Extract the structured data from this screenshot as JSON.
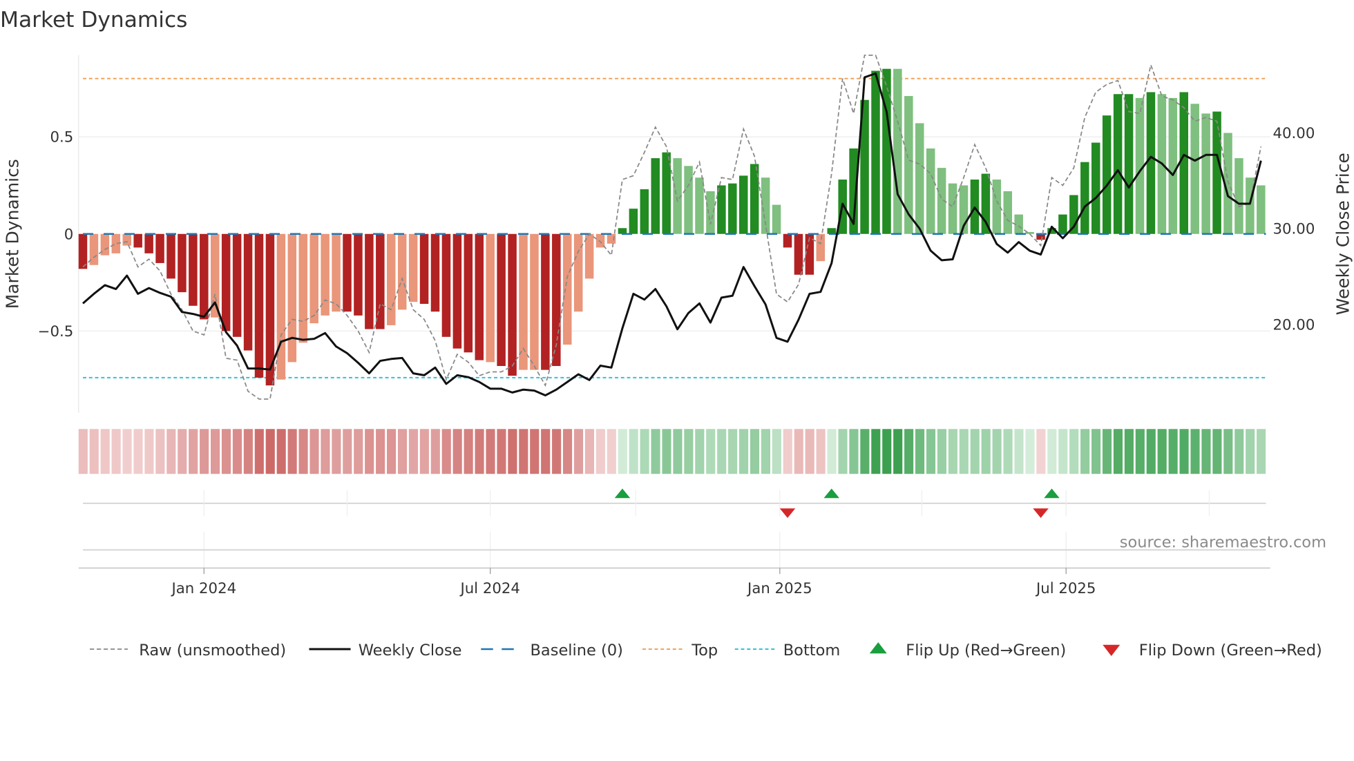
{
  "chart_data": {
    "type": "bar",
    "title": "Market Dynamics",
    "ylabel": "Market Dynamics",
    "y2label": "Weekly Close Price",
    "ylim": [
      -0.92,
      0.92
    ],
    "y2lim": [
      10.8,
      48.1
    ],
    "yticks": [
      {
        "v": 0.5,
        "label": "0.5"
      },
      {
        "v": 0,
        "label": "0"
      },
      {
        "v": -0.5,
        "label": "−0.5"
      }
    ],
    "y2ticks": [
      {
        "v": 40,
        "label": "40.00"
      },
      {
        "v": 30,
        "label": "30.00"
      },
      {
        "v": 20,
        "label": "20.00"
      }
    ],
    "xticks": [
      {
        "week": 11,
        "label": "Jan 2024"
      },
      {
        "week": 37,
        "label": "Jul 2024"
      },
      {
        "week": 63.3,
        "label": "Jan 2025"
      },
      {
        "week": 89.3,
        "label": "Jul 2025"
      }
    ],
    "minor_xticks": [
      24,
      50.2,
      76.2,
      102.3
    ],
    "weeks_start": "2023-10-16 (approx.)",
    "top_level": 0.8,
    "bottom_level": -0.74,
    "baseline": 0,
    "momentum": [
      -0.18,
      -0.16,
      -0.11,
      -0.1,
      -0.06,
      -0.07,
      -0.1,
      -0.15,
      -0.23,
      -0.3,
      -0.37,
      -0.44,
      -0.43,
      -0.5,
      -0.53,
      -0.6,
      -0.74,
      -0.78,
      -0.75,
      -0.66,
      -0.56,
      -0.46,
      -0.42,
      -0.4,
      -0.4,
      -0.42,
      -0.49,
      -0.49,
      -0.47,
      -0.39,
      -0.35,
      -0.36,
      -0.4,
      -0.53,
      -0.59,
      -0.61,
      -0.65,
      -0.66,
      -0.68,
      -0.73,
      -0.7,
      -0.7,
      -0.7,
      -0.68,
      -0.57,
      -0.4,
      -0.23,
      -0.07,
      -0.05,
      0.03,
      0.13,
      0.23,
      0.39,
      0.42,
      0.39,
      0.35,
      0.29,
      0.22,
      0.25,
      0.26,
      0.3,
      0.36,
      0.29,
      0.15,
      -0.07,
      -0.21,
      -0.21,
      -0.14,
      0.03,
      0.28,
      0.44,
      0.69,
      0.84,
      0.85,
      0.85,
      0.71,
      0.57,
      0.44,
      0.34,
      0.26,
      0.25,
      0.28,
      0.31,
      0.28,
      0.22,
      0.1,
      0.01,
      -0.03,
      0.03,
      0.1,
      0.2,
      0.37,
      0.47,
      0.61,
      0.72,
      0.72,
      0.7,
      0.73,
      0.72,
      0.7,
      0.73,
      0.67,
      0.62,
      0.63,
      0.52,
      0.39,
      0.29,
      0.25
    ],
    "strong": [
      1,
      0,
      0,
      0,
      0,
      1,
      1,
      1,
      1,
      1,
      1,
      1,
      0,
      1,
      1,
      1,
      1,
      1,
      0,
      0,
      0,
      0,
      0,
      0,
      1,
      1,
      1,
      1,
      0,
      0,
      0,
      1,
      1,
      1,
      1,
      1,
      1,
      0,
      1,
      1,
      0,
      0,
      1,
      1,
      0,
      0,
      0,
      0,
      0,
      1,
      1,
      1,
      1,
      1,
      0,
      0,
      0,
      0,
      1,
      1,
      1,
      1,
      0,
      0,
      1,
      1,
      1,
      0,
      1,
      1,
      1,
      1,
      1,
      1,
      0,
      0,
      0,
      0,
      0,
      0,
      0,
      1,
      1,
      0,
      0,
      0,
      0,
      1,
      1,
      1,
      1,
      1,
      1,
      1,
      1,
      1,
      0,
      1,
      0,
      0,
      1,
      0,
      0,
      1,
      0,
      0,
      0,
      0
    ],
    "raw": [
      -0.17,
      -0.12,
      -0.08,
      -0.05,
      -0.04,
      -0.17,
      -0.13,
      -0.19,
      -0.31,
      -0.39,
      -0.5,
      -0.52,
      -0.31,
      -0.64,
      -0.65,
      -0.81,
      -0.85,
      -0.85,
      -0.52,
      -0.44,
      -0.45,
      -0.42,
      -0.34,
      -0.36,
      -0.42,
      -0.5,
      -0.61,
      -0.36,
      -0.39,
      -0.23,
      -0.39,
      -0.44,
      -0.55,
      -0.75,
      -0.62,
      -0.66,
      -0.73,
      -0.71,
      -0.71,
      -0.68,
      -0.59,
      -0.68,
      -0.78,
      -0.57,
      -0.22,
      -0.09,
      0.0,
      -0.04,
      -0.11,
      0.28,
      0.3,
      0.42,
      0.55,
      0.45,
      0.17,
      0.25,
      0.37,
      0.05,
      0.29,
      0.28,
      0.54,
      0.4,
      0.05,
      -0.31,
      -0.35,
      -0.26,
      -0.02,
      -0.05,
      0.31,
      0.8,
      0.62,
      0.92,
      0.92,
      0.76,
      0.58,
      0.38,
      0.36,
      0.31,
      0.18,
      0.14,
      0.29,
      0.46,
      0.34,
      0.17,
      0.07,
      0.04,
      0.0,
      -0.06,
      0.29,
      0.25,
      0.34,
      0.6,
      0.73,
      0.77,
      0.79,
      0.63,
      0.62,
      0.87,
      0.71,
      0.69,
      0.65,
      0.58,
      0.6,
      0.58,
      0.27,
      0.14,
      0.16,
      0.45
    ],
    "price": [
      22.2,
      23.2,
      24.1,
      23.7,
      25.1,
      23.2,
      23.8,
      23.3,
      22.9,
      21.3,
      21.1,
      20.8,
      22.3,
      19.2,
      17.8,
      15.4,
      15.4,
      15.3,
      18.2,
      18.6,
      18.4,
      18.5,
      19.1,
      17.7,
      17.0,
      16.0,
      14.9,
      16.2,
      16.4,
      16.5,
      14.9,
      14.7,
      15.5,
      13.8,
      14.7,
      14.5,
      14.0,
      13.3,
      13.3,
      12.9,
      13.2,
      13.1,
      12.6,
      13.2,
      14.0,
      14.8,
      14.2,
      15.7,
      15.5,
      19.6,
      23.2,
      22.6,
      23.7,
      21.9,
      19.5,
      21.2,
      22.2,
      20.2,
      22.8,
      23.0,
      26.0,
      24.0,
      22.1,
      18.6,
      18.2,
      20.5,
      23.2,
      23.4,
      26.4,
      32.6,
      30.5,
      45.8,
      46.2,
      42.2,
      33.6,
      31.5,
      30.0,
      27.7,
      26.7,
      26.8,
      30.3,
      32.2,
      30.7,
      28.4,
      27.5,
      28.6,
      27.7,
      27.3,
      30.2,
      29.0,
      30.2,
      32.3,
      33.2,
      34.5,
      36.1,
      34.3,
      36.0,
      37.5,
      36.8,
      35.6,
      37.7,
      37.1,
      37.7,
      37.7,
      33.4,
      32.6,
      32.6,
      37.1
    ],
    "flips_up": [
      49,
      68,
      88
    ],
    "flips_down": [
      64,
      87
    ],
    "legend": [
      {
        "key": "raw",
        "label": "Raw (unsmoothed)"
      },
      {
        "key": "close",
        "label": "Weekly Close"
      },
      {
        "key": "baseline",
        "label": "Baseline (0)"
      },
      {
        "key": "top",
        "label": "Top"
      },
      {
        "key": "bottom",
        "label": "Bottom"
      },
      {
        "key": "up",
        "label": "Flip Up (Red→Green)"
      },
      {
        "key": "down",
        "label": "Flip Down (Green→Red)"
      }
    ],
    "legend_position": "bottom",
    "source": "source: sharemaestro.com",
    "colors": {
      "red_strong": "#b22222",
      "red_light": "#e9967a",
      "green_strong": "#228b22",
      "green_light": "#7fbf7f",
      "top": "#f0a35e",
      "bottom": "#2ec4d4",
      "baseline": "#1f77b4",
      "up": "#1a9e3f",
      "down": "#d62728"
    }
  }
}
